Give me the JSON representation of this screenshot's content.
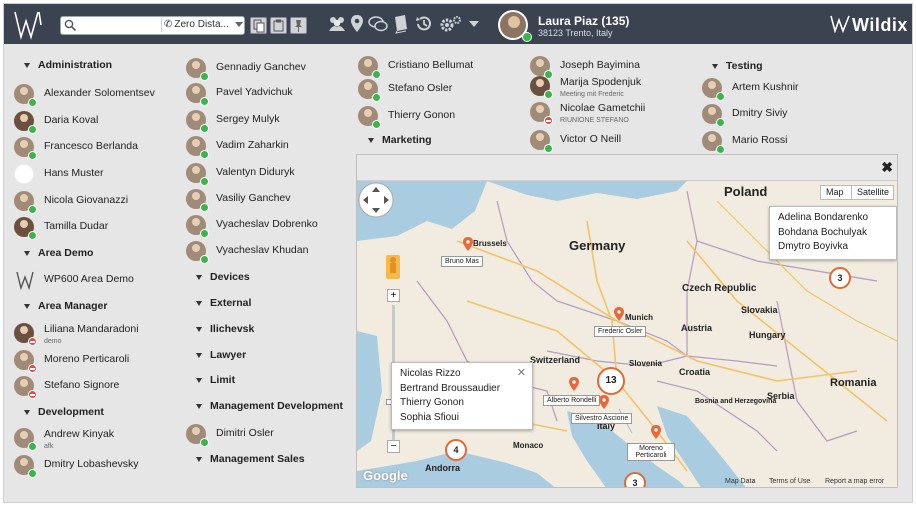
{
  "brand": {
    "name": "Wildix"
  },
  "search": {
    "placeholder": "",
    "mode": "Zero Dista..."
  },
  "user": {
    "name": "Laura Piaz (135)",
    "location": "38123 Trento, Italy"
  },
  "groups": [
    {
      "label": "Administration"
    },
    {
      "label": "Area Demo"
    },
    {
      "label": "Area Manager"
    },
    {
      "label": "Development"
    },
    {
      "label": "Devices"
    },
    {
      "label": "External"
    },
    {
      "label": "Ilichevsk"
    },
    {
      "label": "Lawyer"
    },
    {
      "label": "Limit"
    },
    {
      "label": "Management Development"
    },
    {
      "label": "Management Sales"
    },
    {
      "label": "Marketing"
    },
    {
      "label": "Testing"
    }
  ],
  "users": {
    "col1": [
      {
        "name": "Alexander Solomentsev",
        "status": "g"
      },
      {
        "name": "Daria Koval",
        "status": "g"
      },
      {
        "name": "Francesco Berlanda",
        "status": "g"
      },
      {
        "name": "Hans Muster",
        "status": "gy"
      },
      {
        "name": "Nicola Giovanazzi",
        "status": "g"
      },
      {
        "name": "Tamilla Dudar",
        "status": "g"
      },
      {
        "name": "WP600 Area Demo",
        "status": ""
      },
      {
        "name": "Liliana Mandaradoni",
        "sub": "demo",
        "status": "r"
      },
      {
        "name": "Moreno Perticaroli",
        "status": "r"
      },
      {
        "name": "Stefano Signore",
        "status": "r"
      },
      {
        "name": "Andrew Kinyak",
        "sub": "afk",
        "status": "g"
      },
      {
        "name": "Dmitry Lobashevsky",
        "status": "g"
      }
    ],
    "col2": [
      {
        "name": "Gennadiy Ganchev",
        "status": "g"
      },
      {
        "name": "Pavel Yadvichuk",
        "status": "g"
      },
      {
        "name": "Sergey Mulyk",
        "status": "g"
      },
      {
        "name": "Vadim Zaharkin",
        "status": "g"
      },
      {
        "name": "Valentyn Diduryk",
        "status": "g"
      },
      {
        "name": "Vasiliy Ganchev",
        "status": "g"
      },
      {
        "name": "Vyacheslav Dobrenko",
        "status": "g"
      },
      {
        "name": "Vyacheslav Khudan",
        "status": "g"
      },
      {
        "name": "Dimitri Osler",
        "status": "g"
      }
    ],
    "col3": [
      {
        "name": "Cristiano Bellumat",
        "status": "g"
      },
      {
        "name": "Stefano Osler",
        "status": "g"
      },
      {
        "name": "Thierry Gonon",
        "status": "g"
      }
    ],
    "col4": [
      {
        "name": "Joseph Bayimina",
        "status": "g"
      },
      {
        "name": "Marija Spodenjuk",
        "sub": "Meeting mit Frederic",
        "status": "g"
      },
      {
        "name": "Nicolae Gametchii",
        "sub": "RIUNIONE STEFANO",
        "status": "r"
      },
      {
        "name": "Victor O Neill",
        "status": "g"
      }
    ],
    "col5": [
      {
        "name": "Artem Kushnir",
        "status": "g"
      },
      {
        "name": "Dmitry Siviy",
        "status": "g"
      },
      {
        "name": "Mario Rossi",
        "status": "g"
      }
    ]
  },
  "map": {
    "type_buttons": [
      "Map",
      "Satellite"
    ],
    "countries": [
      "Poland",
      "Germany",
      "Czech Republic",
      "Slovakia",
      "Austria",
      "Hungary",
      "Switzerland",
      "Croatia",
      "Romania",
      "Serbia",
      "Bosnia and Herzegovina",
      "Slovenia",
      "Italy",
      "Monaco",
      "Andorra",
      "Brussels",
      "Munich"
    ],
    "callout_east": [
      "Adelina Bondarenko",
      "Bohdana Bochulyak",
      "Dmytro Boyivka"
    ],
    "callout_west": [
      "Nicolas Rizzo",
      "Bertrand Broussaudier",
      "Thierry Gonon",
      "Sophia Sfioui"
    ],
    "clusters": [
      "3",
      "13",
      "4",
      "3"
    ],
    "pin_labels": [
      "Bruno Mas",
      "Frederic Osler",
      "Alberto Rondelli",
      "Silvestro Ascione",
      "Moreno Perticaroli"
    ],
    "footer": [
      "Map Data",
      "Terms of Use",
      "Report a map error"
    ],
    "attribution": "Google"
  },
  "colors": {
    "topbar": "#3b4250",
    "online": "#39b54a",
    "busy": "#e24b4b",
    "cluster": "#e06a33"
  }
}
